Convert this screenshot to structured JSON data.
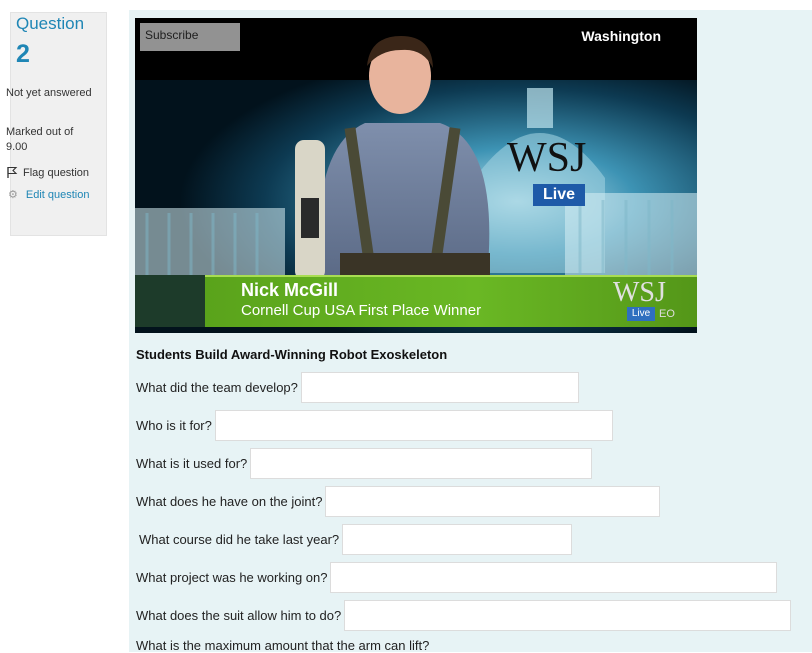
{
  "question_info": {
    "label": "Question",
    "number": "2",
    "state": "Not yet answered",
    "grade": "Marked out of 9.00",
    "flag_label": "Flag question",
    "edit_label": "Edit question"
  },
  "video": {
    "subscribe_label": "Subscribe",
    "location": "Washington",
    "logo_text": "WSJ",
    "logo_badge": "Live",
    "caption_name": "Nick McGill",
    "caption_sub": "Cornell Cup USA First Place Winner",
    "corner_logo": "WSJ",
    "corner_badge": "Live",
    "corner_badge2": "EO"
  },
  "article_title": "Students Build Award-Winning Robot Exoskeleton",
  "questions": [
    {
      "label": "What did the team develop?",
      "value": ""
    },
    {
      "label": "Who is it for?",
      "value": ""
    },
    {
      "label": "What is it used for?",
      "value": ""
    },
    {
      "label": "What does he have on the joint?",
      "value": ""
    },
    {
      "label": "What course did he take last year?",
      "value": ""
    },
    {
      "label": "What project was he working on?",
      "value": ""
    },
    {
      "label": "What does the suit allow him to do?",
      "value": ""
    },
    {
      "label": "What is the maximum amount that the arm can lift?",
      "value": ""
    }
  ],
  "colors": {
    "accent": "#1f86b5",
    "content_bg": "#e7f3f5",
    "info_bg": "#f0f0f0",
    "caption_green": "#6ab824"
  }
}
